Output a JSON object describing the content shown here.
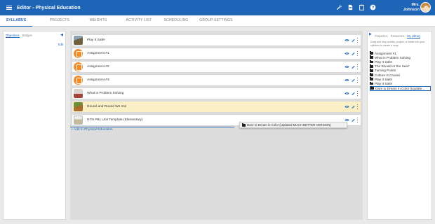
{
  "header": {
    "title": "Editor - Physical Education",
    "user_line1": "Mrs.",
    "user_line2": "Johnson",
    "icons": [
      "wrench-icon",
      "document-icon",
      "clipboard-icon",
      "help-icon"
    ]
  },
  "tabs": [
    "SYLLABUS",
    "PROJECTS",
    "WEIGHTS",
    "ACTIVITY LIST",
    "SCHEDULING",
    "GROUP SETTINGS"
  ],
  "left_panel": {
    "tabs": [
      "Objectives",
      "Badges"
    ],
    "edit_label": "Edit"
  },
  "syllabus": {
    "items": [
      {
        "label": "Play It Safe!",
        "thumb": "photo"
      },
      {
        "label": "Assignment #1",
        "thumb": "assignment-icon"
      },
      {
        "label": "Assignment #2",
        "thumb": "assignment-icon"
      },
      {
        "label": "Assignment #3",
        "thumb": "assignment-icon"
      },
      {
        "label": "What is Problem Solving",
        "thumb": "photo"
      },
      {
        "label": "Round and Round We Go!",
        "thumb": "photo"
      },
      {
        "label": "NTN PBL Unit Template (Elementary)",
        "thumb": "photo"
      }
    ],
    "highlight_color": "#fbf0c5",
    "add_link": "+ Add to Physical Education",
    "drag_ghost": "Dare to Dream in Color (Updated MUCH BETTER VERSION)"
  },
  "right_panel": {
    "tabs": [
      "Properties",
      "Resources",
      "My Library"
    ],
    "help_text": "Drag and drop activity, project, or folder into your syllabus to create a copy.",
    "library": [
      "Assignment #1",
      "What is Problem Solving",
      "Play It Safe!",
      "The Should or the Sea?",
      "Turning Points",
      "Culture is Crucial",
      "Play It Safe!",
      "Play It Safe!",
      "Dare to Dream in Color (Update..."
    ]
  },
  "colors": {
    "brand": "#1f65b7",
    "assignment": "#f28c28"
  }
}
